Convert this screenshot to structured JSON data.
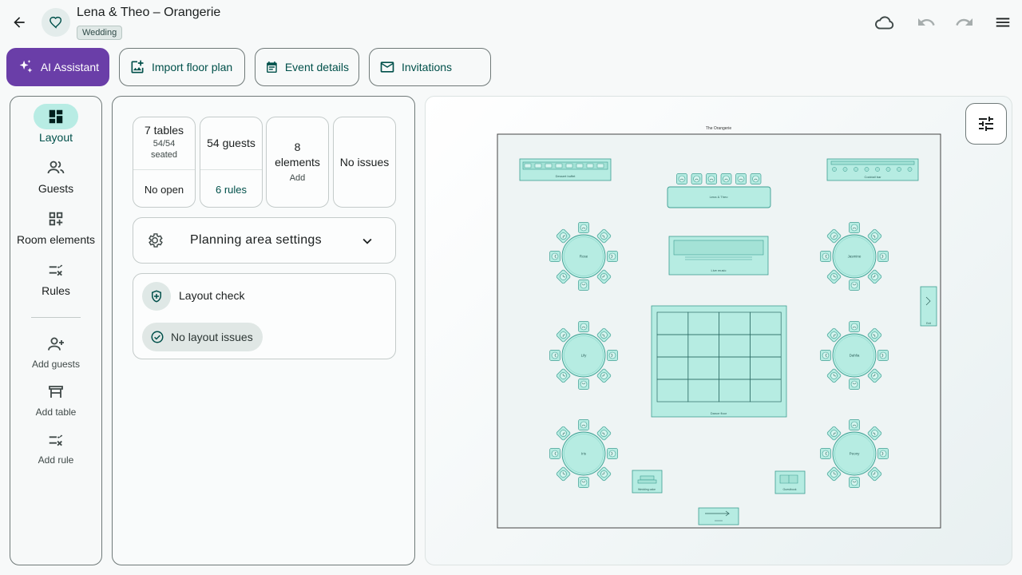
{
  "header": {
    "title": "Lena & Theo – Orangerie",
    "badge": "Wedding"
  },
  "toolbar": {
    "ai_assistant": "AI Assistant",
    "import_floor_plan": "Import floor plan",
    "event_details": "Event details",
    "invitations": "Invitations"
  },
  "rail": {
    "layout": "Layout",
    "guests": "Guests",
    "room_elements": "Room elements",
    "rules": "Rules",
    "add_guests": "Add guests",
    "add_table": "Add table",
    "add_rule": "Add rule"
  },
  "stats": {
    "tables": {
      "title": "7 tables",
      "sub": "54/54",
      "sub2": "seated",
      "footer": "No open"
    },
    "guests": {
      "title": "54 guests",
      "footer": "6 rules"
    },
    "elements": {
      "title": "8",
      "title2": "elements",
      "footer": "Add"
    },
    "issues": {
      "title": "No issues"
    }
  },
  "planning": {
    "label": "Planning area settings"
  },
  "layout_check": {
    "title": "Layout check",
    "chip": "No layout issues"
  },
  "floorplan": {
    "room_title": "The Orangerie",
    "head_table": "Lena & Theo",
    "dessert_buffet": "Dessert buffet",
    "cocktail_bar": "Cocktail bar",
    "live_music": "Live music",
    "dance_floor": "Dance floor",
    "exit": "Exit",
    "wedding_cake": "Wedding cake",
    "guestbook": "Guestbook",
    "tables": [
      "Rose",
      "Jasmine",
      "Lily",
      "Dahlia",
      "Iris",
      "Peony"
    ]
  },
  "colors": {
    "accent": "#00504a",
    "ai_button": "#6a3ea8",
    "element_fill": "#b6ece2",
    "element_stroke": "#3e9e92"
  }
}
